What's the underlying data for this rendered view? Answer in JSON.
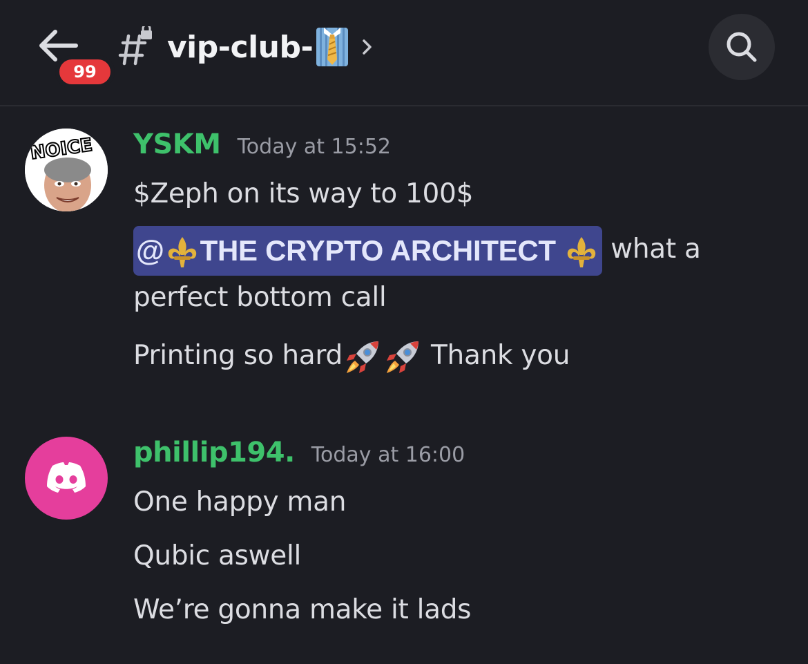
{
  "header": {
    "back_label": "Back",
    "unread_badge": "99",
    "channel_name": "vip-club-",
    "channel_emoji": "necktie-emoji",
    "search_icon": "search-icon"
  },
  "messages": [
    {
      "username": "YSKM",
      "username_color": "#3ec16b",
      "timestamp": "Today at 15:52",
      "avatar_text": "NOICE",
      "lines": {
        "l1": "$Zeph on its way to 100$",
        "mention_at": "@",
        "mention_name": "THE CRYPTO ARCHITECT",
        "after_mention": "what a",
        "l2b": "perfect bottom call",
        "l3a": "Printing so hard",
        "l3b": "Thank you"
      }
    },
    {
      "username": "phillip194.",
      "username_color": "#3ec16b",
      "timestamp": "Today at 16:00",
      "avatar_color": "#e53e9c",
      "lines": {
        "l1": "One happy man",
        "l2": "Qubic aswell",
        "l3": "We’re gonna make it lads"
      }
    }
  ]
}
